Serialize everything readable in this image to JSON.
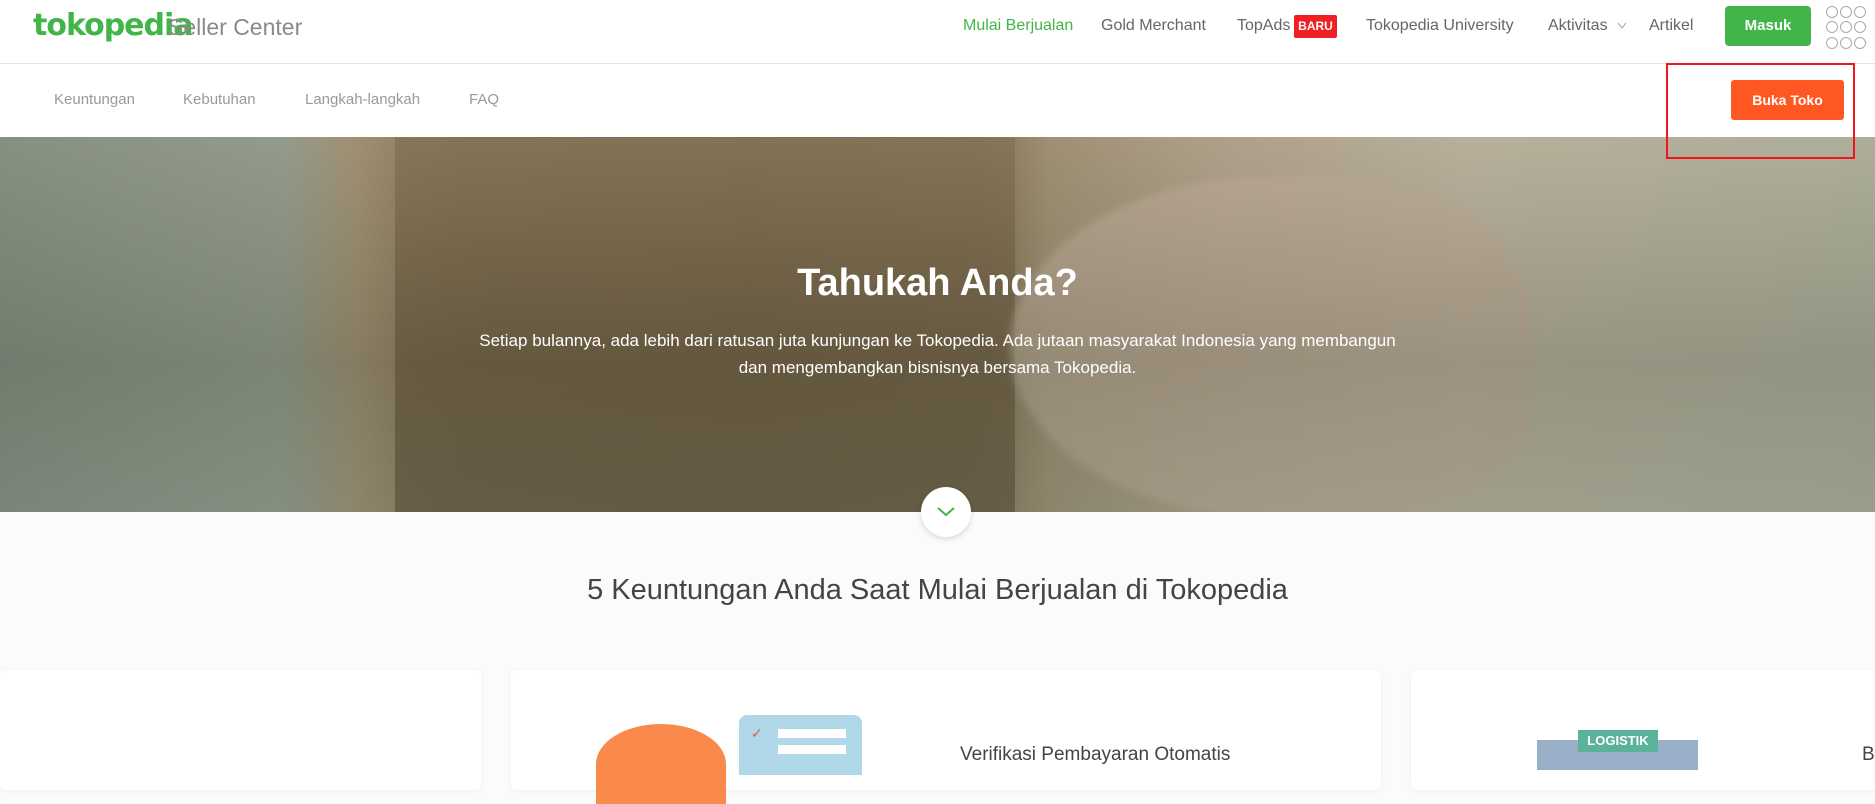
{
  "header": {
    "logo": "tokopedia",
    "logo_sub": "Seller Center",
    "nav": [
      "Mulai Berjualan",
      "Gold Merchant",
      "TopAds",
      "Tokopedia University",
      "Aktivitas",
      "Artikel"
    ],
    "badge": "BARU",
    "login": "Masuk"
  },
  "subnav": {
    "items": [
      "Keuntungan",
      "Kebutuhan",
      "Langkah-langkah",
      "FAQ"
    ],
    "cta": "Buka Toko"
  },
  "hero": {
    "title": "Tahukah Anda?",
    "text": "Setiap bulannya, ada lebih dari ratusan juta kunjungan ke Tokopedia. Ada jutaan masyarakat Indonesia yang membangun dan mengembangkan bisnisnya bersama Tokopedia."
  },
  "section": {
    "title": "5 Keuntungan Anda Saat Mulai Berjualan di Tokopedia",
    "cards": [
      {
        "title": "Verifikasi Pembayaran Otomatis"
      },
      {
        "tag": "LOGISTIK",
        "title": "B"
      }
    ]
  },
  "colors": {
    "brand": "#42b549",
    "cta": "#ff5722",
    "badge": "#ef1f24"
  }
}
